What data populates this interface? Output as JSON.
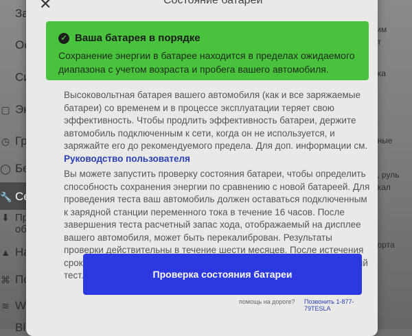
{
  "background": {
    "menu": [
      {
        "label": "Замк",
        "icon": ""
      },
      {
        "label": "Осве",
        "icon": ""
      },
      {
        "label": "Сиде",
        "icon": ""
      },
      {
        "label": "Экра",
        "icon": "▢"
      },
      {
        "label": "Граф",
        "icon": "◷"
      },
      {
        "label": "Безо",
        "icon": "◯"
      },
      {
        "label": "Серв",
        "icon": "🔧"
      },
      {
        "label": "Пров",
        "icon": "⬇"
      },
      {
        "label": "обес",
        "icon": ""
      },
      {
        "label": "Нави",
        "icon": "▲"
      },
      {
        "label": "Поез",
        "icon": "⌘"
      },
      {
        "label": "Wi-F",
        "icon": "≋"
      },
      {
        "label": "Blue",
        "icon": ""
      }
    ],
    "right_fragments": [
      "ким",
      "ат",
      "йка",
      "нные",
      "ь, руль",
      "ркал",
      "порта"
    ]
  },
  "dialog": {
    "title": "Состояние батареи",
    "status_title": "Ваша батарея в порядке",
    "status_body": "Сохранение энергии в батарее находится в пределах ожидаемого диапазона с учетом возраста и пробега вашего автомобиля.",
    "paragraph1": "Высоковольтная батарея вашего автомобиля (как и все заряжаемые батареи) со временем и в процессе эксплуатации теряет свою эффективность. Чтобы продлить эффективность батареи, держите автомобиль подключенным к сети, когда он не используется, и заряжайте его до рекомендуемого предела. Для доп. информации см.",
    "manual_link": "Руководство пользователя",
    "paragraph2": "Вы можете запустить проверку состояния батареи, чтобы определить способность сохранения энергии по сравнению с новой батареей. Для проведения теста ваш автомобиль должен оставаться подключенным к зарядной станции переменного тока в течение 16 часов. После завершения теста расчетный запас хода, отображаемый на дисплее вашего автомобиля, может быть перекалиброван. Результаты проверки действительны в течение шести месяцев. После истечения срока действия результатов, у вас будет возможность провести новый тест.",
    "button_label": "Проверка состояния батареи",
    "footer_question": "помощь на дороге?",
    "footer_phone": "Позвонить 1-877-79TESLA"
  },
  "colors": {
    "status_green": "#49c33d",
    "button_blue": "#2d39e0",
    "link_blue": "#2a3fb6"
  }
}
